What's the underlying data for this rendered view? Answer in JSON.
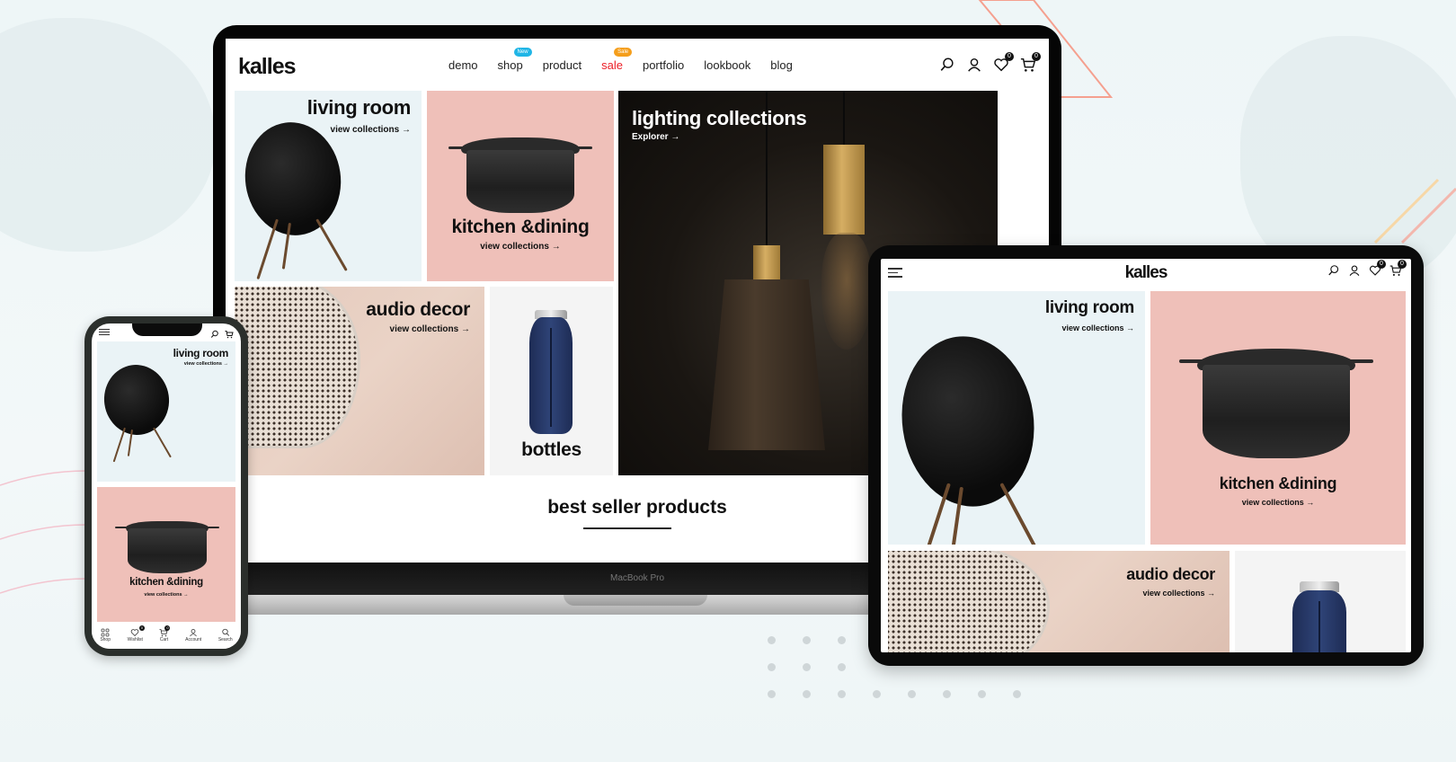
{
  "brand": {
    "logo": "kalles"
  },
  "colors": {
    "new_badge": "#1fb5e6",
    "sale_badge": "#f59e1b",
    "sale_link": "#ec1f27",
    "pink_tile": "#efc0b9",
    "icy_tile": "#eaf3f6"
  },
  "laptop": {
    "device_label": "MacBook Pro",
    "nav": [
      {
        "label": "demo"
      },
      {
        "label": "shop",
        "badge": "New"
      },
      {
        "label": "product"
      },
      {
        "label": "sale",
        "badge": "Sale"
      },
      {
        "label": "portfolio"
      },
      {
        "label": "lookbook"
      },
      {
        "label": "blog"
      }
    ],
    "header_icons": [
      {
        "icon": "search-icon"
      },
      {
        "icon": "user-icon"
      },
      {
        "icon": "heart-icon",
        "count": "0"
      },
      {
        "icon": "cart-icon",
        "count": "0"
      }
    ],
    "tiles": {
      "living_room": {
        "title": "living room",
        "link": "view collections →"
      },
      "kitchen": {
        "title": "kitchen &dining",
        "link": "view collections →"
      },
      "lighting": {
        "title": "lighting collections",
        "link": "Explorer →"
      },
      "audio": {
        "title": "audio decor",
        "link": "view collections →"
      },
      "bottles": {
        "title": "bottles"
      }
    },
    "section_title": "best seller products"
  },
  "tablet": {
    "header_icons": [
      {
        "icon": "search-icon"
      },
      {
        "icon": "user-icon"
      },
      {
        "icon": "heart-icon",
        "count": "0"
      },
      {
        "icon": "cart-icon",
        "count": "0"
      }
    ],
    "tiles": {
      "living_room": {
        "title": "living room",
        "link": "view collections →"
      },
      "kitchen": {
        "title": "kitchen &dining",
        "link": "view collections →"
      },
      "audio": {
        "title": "audio decor",
        "link": "view collections →"
      }
    }
  },
  "phone": {
    "tiles": {
      "living_room": {
        "title": "living room",
        "link": "view collections →"
      },
      "kitchen": {
        "title": "kitchen &dining",
        "link": "view collections →"
      }
    },
    "tabbar": [
      {
        "label": "Shop",
        "icon": "grid-icon"
      },
      {
        "label": "Wishlist",
        "icon": "heart-icon",
        "count": "0"
      },
      {
        "label": "Cart",
        "icon": "cart-icon",
        "count": "0"
      },
      {
        "label": "Account",
        "icon": "user-icon"
      },
      {
        "label": "Search",
        "icon": "search-icon"
      }
    ]
  }
}
